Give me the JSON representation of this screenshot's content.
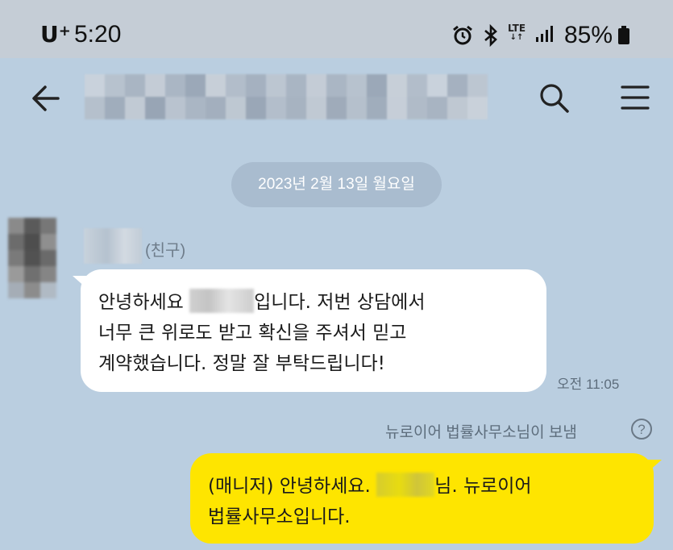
{
  "status_bar": {
    "carrier": "U",
    "carrier_sup": "+",
    "time": "5:20",
    "network": "LTE",
    "battery": "85%"
  },
  "chat": {
    "date_divider": "2023년 2월 13일 월요일",
    "friend_tag": "(친구)",
    "incoming": {
      "line1_pre": "안녕하세요",
      "line1_post": "입니다. 저번 상담에서",
      "line2": "너무 큰 위로도 받고 확신을 주셔서 믿고",
      "line3": "계약했습니다. 정말 잘 부탁드립니다!",
      "time": "오전 11:05"
    },
    "sent_by": "뉴로이어 법률사무소님이 보냄",
    "help_symbol": "?",
    "outgoing": {
      "line1_pre": "(매니저) 안녕하세요.",
      "line1_post": "님. 뉴로이어",
      "line2": "법률사무소입니다."
    }
  },
  "colors": {
    "background": "#bacee0",
    "status_bar": "#c5cdd6",
    "outgoing_bubble": "#fee500",
    "incoming_bubble": "#ffffff"
  },
  "icons": [
    "alarm-icon",
    "bluetooth-icon",
    "lte-icon",
    "signal-icon",
    "battery-icon",
    "back-arrow-icon",
    "search-icon",
    "menu-icon",
    "help-icon"
  ]
}
